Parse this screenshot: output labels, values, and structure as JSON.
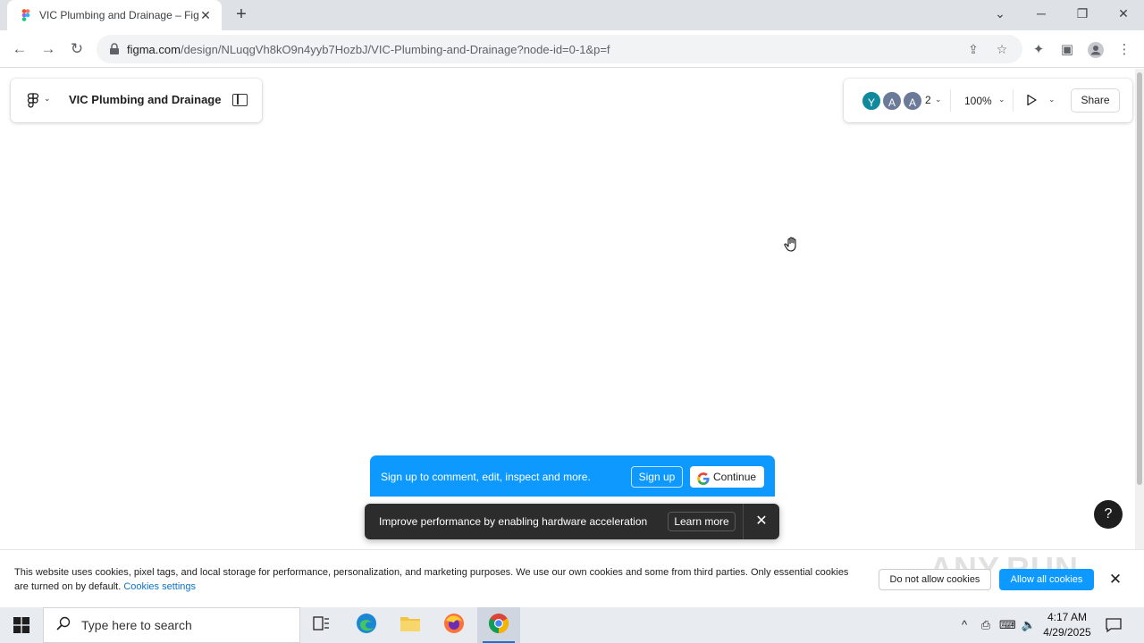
{
  "browser": {
    "tab_title": "VIC Plumbing and Drainage – Figma",
    "url_host": "figma.com",
    "url_path": "/design/NLuqgVh8kO9n4yyb7HozbJ/VIC-Plumbing-and-Drainage?node-id=0-1&p=f"
  },
  "figma": {
    "file_title": "VIC Plumbing and Drainage",
    "avatars": [
      {
        "initial": "Y",
        "color": "#0f8a9c"
      },
      {
        "initial": "A",
        "color": "#6b7a99"
      },
      {
        "initial": "A",
        "color": "#6b7a99"
      }
    ],
    "avatar_count": "2",
    "zoom": "100%",
    "share_label": "Share",
    "help_label": "?"
  },
  "signup_banner": {
    "text": "Sign up to comment, edit, inspect and more.",
    "signup_label": "Sign up",
    "continue_label": "Continue"
  },
  "hw_toast": {
    "text": "Improve performance by enabling hardware acceleration",
    "learn_more": "Learn more"
  },
  "cookie": {
    "text": "This website uses cookies, pixel tags, and local storage for performance, personalization, and marketing purposes. We use our own cookies and some from third parties. Only essential cookies are turned on by default.",
    "settings_link": "Cookies settings",
    "deny_label": "Do not allow cookies",
    "allow_label": "Allow all cookies",
    "watermark": "ANY.RUN"
  },
  "taskbar": {
    "search_placeholder": "Type here to search",
    "time": "4:17 AM",
    "date": "4/29/2025"
  }
}
